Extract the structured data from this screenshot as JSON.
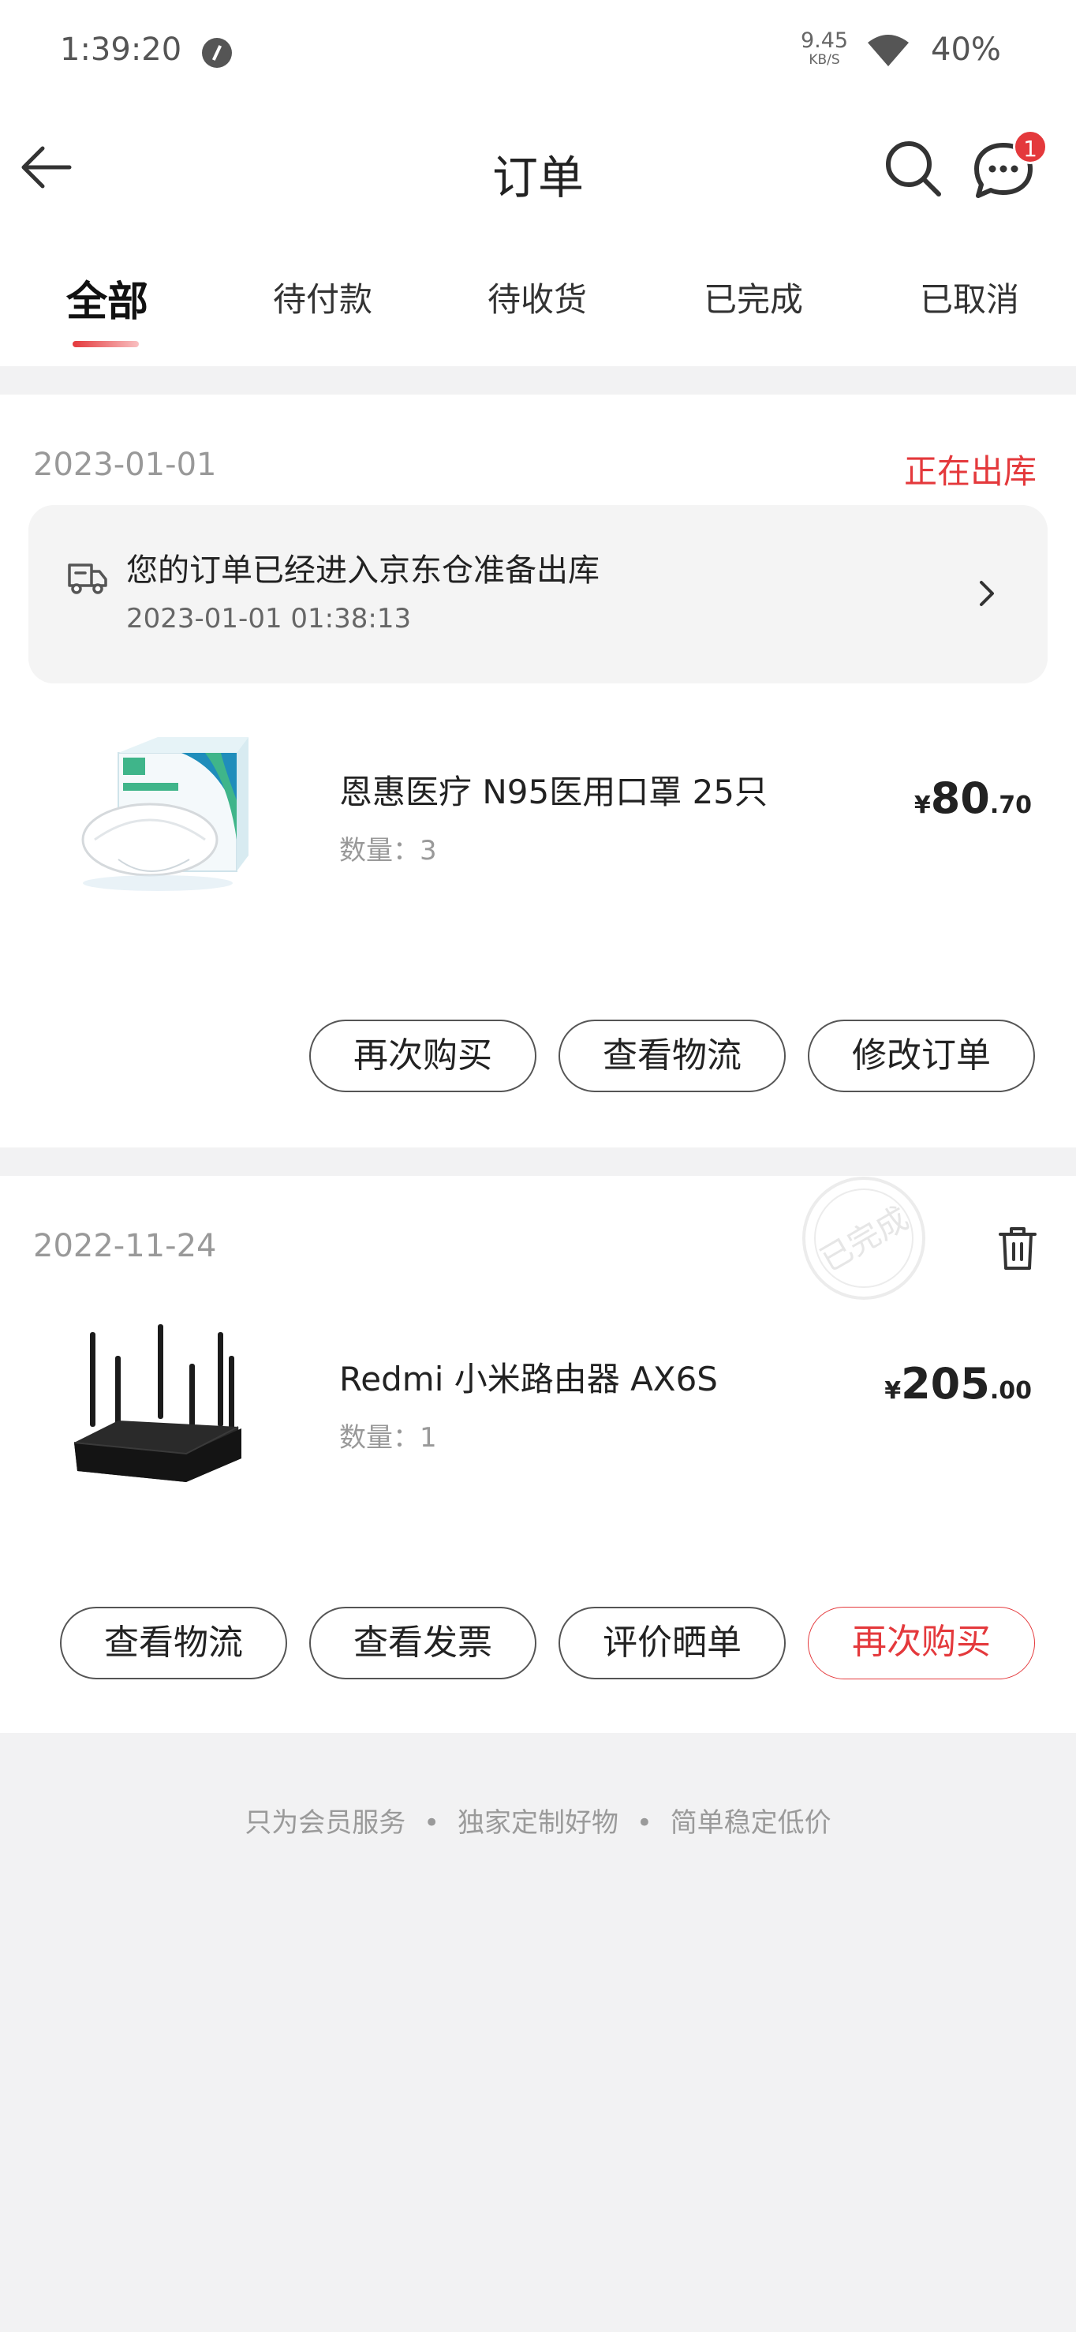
{
  "status_bar": {
    "time": "1:39:20",
    "net_speed": "9.45",
    "net_unit": "KB/S",
    "battery": "40%"
  },
  "header": {
    "title": "订单",
    "message_badge": "1"
  },
  "tabs": [
    {
      "label": "全部",
      "active": true
    },
    {
      "label": "待付款"
    },
    {
      "label": "待收货"
    },
    {
      "label": "已完成"
    },
    {
      "label": "已取消"
    }
  ],
  "orders": [
    {
      "date": "2023-01-01",
      "status": "正在出库",
      "notice": {
        "text": "您的订单已经进入京东仓准备出库",
        "time": "2023-01-01 01:38:13"
      },
      "product": {
        "name": "恩惠医疗 N95医用口罩 25只",
        "qty_label": "数量：3",
        "price_symbol": "¥",
        "price_int": "80",
        "price_dec": ".70",
        "image": "n95-mask-box"
      },
      "buttons": [
        "再次购买",
        "查看物流",
        "修改订单"
      ]
    },
    {
      "date": "2022-11-24",
      "stamp": "已完成",
      "product": {
        "name": "Redmi 小米路由器 AX6S",
        "qty_label": "数量：1",
        "price_symbol": "¥",
        "price_int": "205",
        "price_dec": ".00",
        "image": "wifi-router"
      },
      "buttons": [
        "查看物流",
        "查看发票",
        "评价晒单",
        "再次购买"
      ]
    }
  ],
  "footer": {
    "items": [
      "只为会员服务",
      "独家定制好物",
      "简单稳定低价"
    ],
    "separator": "•"
  },
  "colors": {
    "accent": "#e4393c",
    "background": "#f2f2f3"
  }
}
